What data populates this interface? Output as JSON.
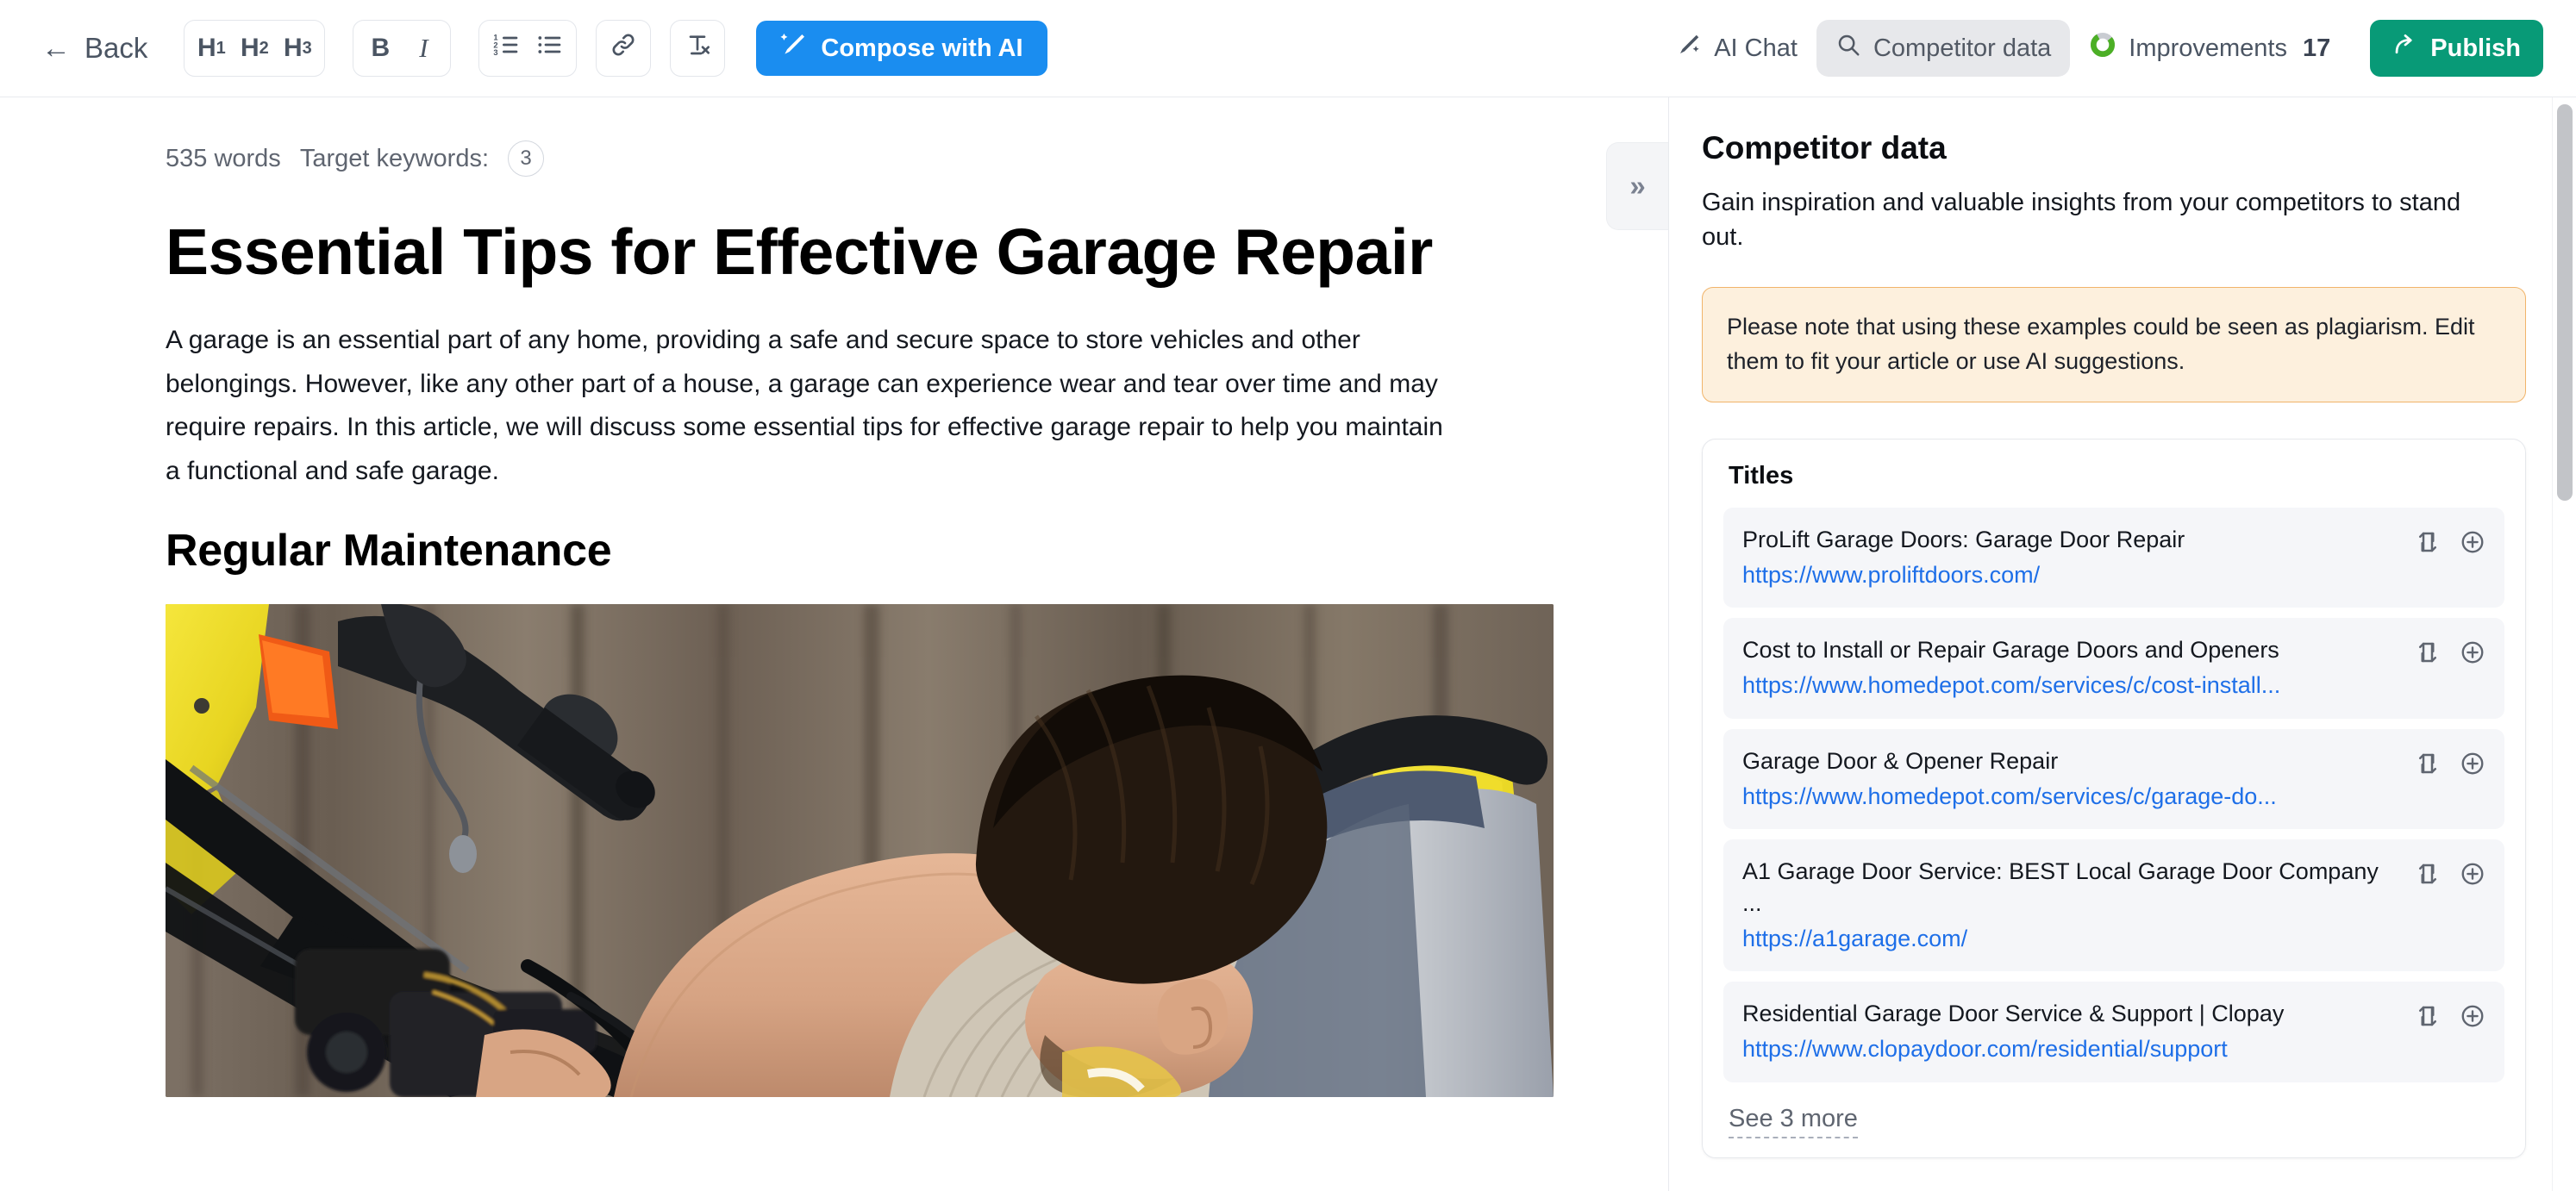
{
  "toolbar": {
    "back_label": "Back",
    "back_icon": "arrow-left-icon",
    "heading_buttons": [
      {
        "name": "h1",
        "label": "H",
        "sub": "1"
      },
      {
        "name": "h2",
        "label": "H",
        "sub": "2"
      },
      {
        "name": "h3",
        "label": "H",
        "sub": "3"
      }
    ],
    "bold_label": "B",
    "italic_label": "I",
    "ordered_list_icon": "ordered-list-icon",
    "bullet_list_icon": "bullet-list-icon",
    "link_icon": "link-icon",
    "clear_format_label": "Tx",
    "compose_label": "Compose with AI",
    "compose_icon": "ai-sparkle-icon",
    "compose_color": "#1a8df0",
    "ai_chat_label": "AI Chat",
    "ai_chat_icon": "ai-sparkle-icon",
    "competitor_label": "Competitor data",
    "competitor_icon": "search-icon",
    "improvements_label": "Improvements",
    "improvements_count": "17",
    "improvements_icon": "progress-ring-icon",
    "improvements_color": "#4caf26",
    "publish_label": "Publish",
    "publish_icon": "share-arrow-icon",
    "publish_color": "#089a77"
  },
  "editor": {
    "word_count": "535 words",
    "target_keywords_label": "Target keywords:",
    "target_keywords_count": "3",
    "title": "Essential Tips for Effective Garage Repair",
    "paragraph": "A garage is an essential part of any home, providing a safe and secure space to store vehicles and other belongings. However, like any other part of a house, a garage can experience wear and tear over time and may require repairs. In this article, we will discuss some essential tips for effective garage repair to help you maintain a functional and safe garage.",
    "heading2": "Regular Maintenance",
    "photo_alt": "man-repairing-yellow-motorcycle-photo",
    "collapse_label": "»"
  },
  "panel": {
    "title": "Competitor data",
    "subtitle": "Gain inspiration and valuable insights from your competitors to stand out.",
    "notice": "Please note that using these examples could be seen as plagiarism. Edit them to fit your article or use AI suggestions.",
    "card_title": "Titles",
    "see_more_label": "See 3 more",
    "items": [
      {
        "title": "ProLift Garage Doors: Garage Door Repair",
        "url": "https://www.proliftdoors.com/"
      },
      {
        "title": "Cost to Install or Repair Garage Doors and Openers",
        "url": "https://www.homedepot.com/services/c/cost-install..."
      },
      {
        "title": "Garage Door & Opener Repair",
        "url": "https://www.homedepot.com/services/c/garage-do..."
      },
      {
        "title": "A1 Garage Door Service: BEST Local Garage Door Company ...",
        "url": "https://a1garage.com/"
      },
      {
        "title": "Residential Garage Door Service & Support | Clopay",
        "url": "https://www.clopaydoor.com/residential/support"
      }
    ],
    "item_replace_icon": "replace-icon",
    "item_add_icon": "plus-circle-icon"
  }
}
